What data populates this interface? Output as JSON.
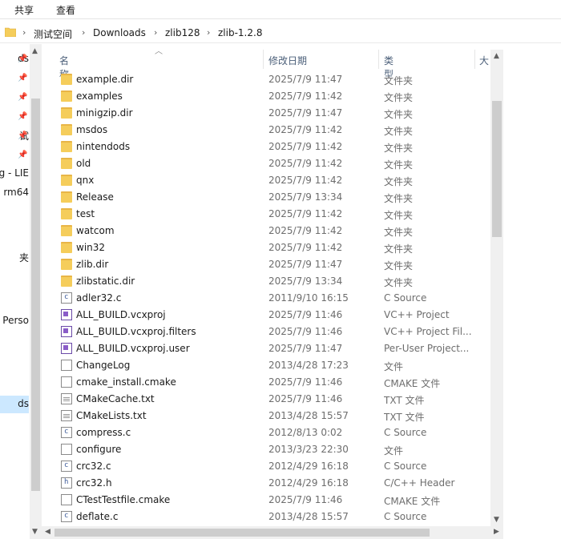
{
  "ribbon": {
    "tabs": [
      "共享",
      "查看"
    ]
  },
  "address": {
    "crumbs": [
      "测试空间",
      "Downloads",
      "zlib128",
      "zlib-1.2.8"
    ]
  },
  "nav": {
    "items": [
      "ds",
      "",
      "",
      "",
      "试",
      "",
      "g - LIE",
      "rm64",
      "夹",
      "- Perso",
      "ds"
    ],
    "pinned_count": 6
  },
  "columns": {
    "name": "名称",
    "date": "修改日期",
    "type": "类型",
    "size": "大"
  },
  "files": [
    {
      "name": "example.dir",
      "date": "2025/7/9 11:47",
      "type": "文件夹",
      "icon": "folder-icon"
    },
    {
      "name": "examples",
      "date": "2025/7/9 11:42",
      "type": "文件夹",
      "icon": "folder-icon"
    },
    {
      "name": "minigzip.dir",
      "date": "2025/7/9 11:47",
      "type": "文件夹",
      "icon": "folder-icon"
    },
    {
      "name": "msdos",
      "date": "2025/7/9 11:42",
      "type": "文件夹",
      "icon": "folder-icon"
    },
    {
      "name": "nintendods",
      "date": "2025/7/9 11:42",
      "type": "文件夹",
      "icon": "folder-icon"
    },
    {
      "name": "old",
      "date": "2025/7/9 11:42",
      "type": "文件夹",
      "icon": "folder-icon"
    },
    {
      "name": "qnx",
      "date": "2025/7/9 11:42",
      "type": "文件夹",
      "icon": "folder-icon"
    },
    {
      "name": "Release",
      "date": "2025/7/9 13:34",
      "type": "文件夹",
      "icon": "folder-icon"
    },
    {
      "name": "test",
      "date": "2025/7/9 11:42",
      "type": "文件夹",
      "icon": "folder-icon"
    },
    {
      "name": "watcom",
      "date": "2025/7/9 11:42",
      "type": "文件夹",
      "icon": "folder-icon"
    },
    {
      "name": "win32",
      "date": "2025/7/9 11:42",
      "type": "文件夹",
      "icon": "folder-icon"
    },
    {
      "name": "zlib.dir",
      "date": "2025/7/9 11:47",
      "type": "文件夹",
      "icon": "folder-icon"
    },
    {
      "name": "zlibstatic.dir",
      "date": "2025/7/9 13:34",
      "type": "文件夹",
      "icon": "folder-icon"
    },
    {
      "name": "adler32.c",
      "date": "2011/9/10 16:15",
      "type": "C Source",
      "icon": "c-source-icon"
    },
    {
      "name": "ALL_BUILD.vcxproj",
      "date": "2025/7/9 11:46",
      "type": "VC++ Project",
      "icon": "vcxproj-icon"
    },
    {
      "name": "ALL_BUILD.vcxproj.filters",
      "date": "2025/7/9 11:46",
      "type": "VC++ Project Fil...",
      "icon": "vcxproj-icon"
    },
    {
      "name": "ALL_BUILD.vcxproj.user",
      "date": "2025/7/9 11:47",
      "type": "Per-User Project...",
      "icon": "vcxproj-icon"
    },
    {
      "name": "ChangeLog",
      "date": "2013/4/28 17:23",
      "type": "文件",
      "icon": "file-icon"
    },
    {
      "name": "cmake_install.cmake",
      "date": "2025/7/9 11:46",
      "type": "CMAKE 文件",
      "icon": "file-icon"
    },
    {
      "name": "CMakeCache.txt",
      "date": "2025/7/9 11:46",
      "type": "TXT 文件",
      "icon": "text-file-icon"
    },
    {
      "name": "CMakeLists.txt",
      "date": "2013/4/28 15:57",
      "type": "TXT 文件",
      "icon": "text-file-icon"
    },
    {
      "name": "compress.c",
      "date": "2012/8/13 0:02",
      "type": "C Source",
      "icon": "c-source-icon"
    },
    {
      "name": "configure",
      "date": "2013/3/23 22:30",
      "type": "文件",
      "icon": "file-icon"
    },
    {
      "name": "crc32.c",
      "date": "2012/4/29 16:18",
      "type": "C Source",
      "icon": "c-source-icon"
    },
    {
      "name": "crc32.h",
      "date": "2012/4/29 16:18",
      "type": "C/C++ Header",
      "icon": "header-icon"
    },
    {
      "name": "CTestTestfile.cmake",
      "date": "2025/7/9 11:46",
      "type": "CMAKE 文件",
      "icon": "file-icon"
    },
    {
      "name": "deflate.c",
      "date": "2013/4/28 15:57",
      "type": "C Source",
      "icon": "c-source-icon"
    }
  ]
}
